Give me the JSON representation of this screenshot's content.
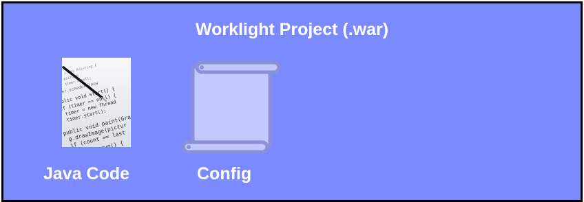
{
  "title": "Worklight Project (.war)",
  "items": [
    {
      "label": "Java Code",
      "icon": "java-code-image"
    },
    {
      "label": "Config",
      "icon": "scroll-icon"
    }
  ],
  "colors": {
    "background": "#7b8bff",
    "border": "#000000",
    "text": "#ffffff",
    "scroll_fill": "#c3c8ff",
    "scroll_stroke": "#8a91d6"
  }
}
